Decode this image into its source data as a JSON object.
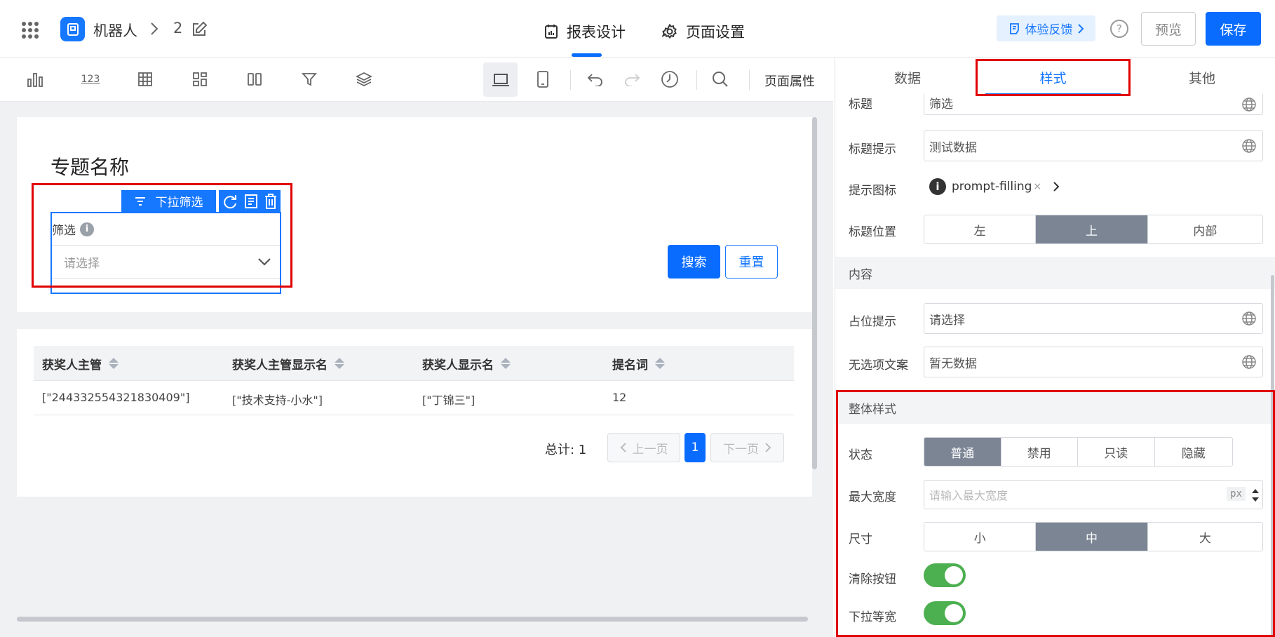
{
  "header": {
    "app_name": "机器人",
    "page_number": "2",
    "tabs": [
      {
        "label": "报表设计",
        "active": true
      },
      {
        "label": "页面设置",
        "active": false
      }
    ],
    "feedback_label": "体验反馈",
    "preview_label": "预览",
    "save_label": "保存"
  },
  "toolbar": {
    "page_props_label": "页面属性",
    "icons": [
      "bar-chart-icon",
      "number-icon",
      "table-icon",
      "grid-icon",
      "columns-icon",
      "filter-icon",
      "layers-icon",
      "desktop-icon",
      "mobile-icon",
      "undo-icon",
      "redo-icon",
      "history-icon",
      "search-icon"
    ],
    "number_icon_text": "123"
  },
  "canvas": {
    "title": "专题名称",
    "filter_widget": {
      "tag_label": "下拉筛选",
      "label": "筛选",
      "placeholder": "请选择"
    },
    "search_label": "搜索",
    "reset_label": "重置",
    "table": {
      "columns": [
        "获奖人主管",
        "获奖人主管显示名",
        "获奖人显示名",
        "提名词"
      ],
      "rows": [
        [
          "[\"244332554321830409\"]",
          "[\"技术支持-小水\"]",
          "[\"丁锦三\"]",
          "12"
        ]
      ]
    },
    "pagination": {
      "total": "总计: 1",
      "prev": "上一页",
      "current": "1",
      "next": "下一页"
    }
  },
  "panel": {
    "tabs": [
      {
        "label": "数据"
      },
      {
        "label": "样式",
        "active": true
      },
      {
        "label": "其他"
      }
    ],
    "title_label": "标题",
    "title_value": "筛选",
    "title_hint_label": "标题提示",
    "title_hint_value": "测试数据",
    "hint_icon_label": "提示图标",
    "hint_icon_value": "prompt-filling",
    "title_pos_label": "标题位置",
    "title_pos_options": [
      "左",
      "上",
      "内部"
    ],
    "title_pos_selected": "上",
    "content_section": "内容",
    "placeholder_label": "占位提示",
    "placeholder_value": "请选择",
    "no_option_label": "无选项文案",
    "no_option_value": "暂无数据",
    "overall_section": "整体样式",
    "state_label": "状态",
    "state_options": [
      "普通",
      "禁用",
      "只读",
      "隐藏"
    ],
    "state_selected": "普通",
    "max_width_label": "最大宽度",
    "max_width_placeholder": "请输入最大宽度",
    "max_width_unit": "px",
    "size_label": "尺寸",
    "size_options": [
      "小",
      "中",
      "大"
    ],
    "size_selected": "中",
    "clear_btn_label": "清除按钮",
    "clear_btn_on": true,
    "dropdown_equal_label": "下拉等宽",
    "dropdown_equal_on": true
  },
  "colors": {
    "primary": "#0a6cff",
    "highlight": "#e00000",
    "segment_active": "#7b8594",
    "toggle": "#4caf50"
  }
}
